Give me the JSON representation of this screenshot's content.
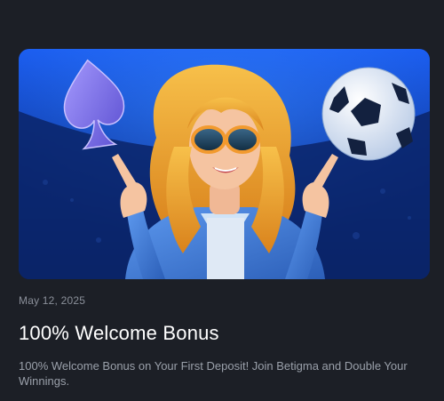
{
  "promo": {
    "date": "May 12, 2025",
    "title": "100% Welcome Bonus",
    "description": "100% Welcome Bonus on Your First Deposit! Join Betigma and Double Your Winnings."
  },
  "banner": {
    "icons": [
      "spade-icon",
      "soccer-ball-icon"
    ],
    "colors": {
      "background": "#1c1f26",
      "banner_top": "#1a5cf0",
      "banner_bottom": "#0a2262",
      "spade": "#7b6fe0",
      "hair": "#f2a531",
      "jacket": "#3e79d6"
    }
  }
}
